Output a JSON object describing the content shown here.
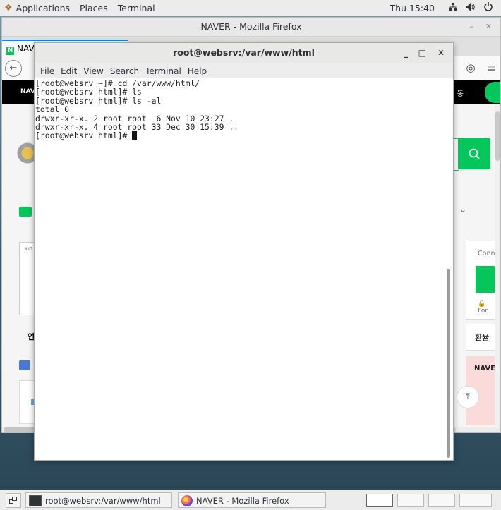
{
  "topbar": {
    "applications": "Applications",
    "places": "Places",
    "terminal": "Terminal",
    "clock": "Thu 15:40",
    "icons": [
      "network-icon",
      "volume-icon",
      "power-icon"
    ]
  },
  "firefox": {
    "window_title": "NAVER - Mozilla Firefox",
    "tab_label": "NAV",
    "naver_logo": "NAV",
    "nav_right_text": "동",
    "right_card_label": "Conne",
    "right_card_lock": "🔒 For",
    "side_box_text": "un",
    "label_yeon": "연",
    "exchange_label": "환율",
    "pink_card_label": "NAVE"
  },
  "terminal": {
    "window_title": "root@websrv:/var/www/html",
    "menu": [
      "File",
      "Edit",
      "View",
      "Search",
      "Terminal",
      "Help"
    ],
    "lines": [
      {
        "text": "[root@websrv ~]# cd /var/www/html/",
        "dir": ""
      },
      {
        "text": "[root@websrv html]# ls",
        "dir": ""
      },
      {
        "text": "[root@websrv html]# ls -al",
        "dir": ""
      },
      {
        "text": "total 0",
        "dir": ""
      },
      {
        "text": "drwxr-xr-x. 2 root root  6 Nov 10 23:27 ",
        "dir": "."
      },
      {
        "text": "drwxr-xr-x. 4 root root 33 Dec 30 15:39 ",
        "dir": ".."
      }
    ],
    "prompt": "[root@websrv html]# "
  },
  "taskbar": {
    "tasks": [
      {
        "label": "root@websrv:/var/www/html",
        "icon": "terminal-icon"
      },
      {
        "label": "NAVER - Mozilla Firefox",
        "icon": "firefox-icon"
      }
    ],
    "workspaces": 4,
    "active_workspace": 1
  }
}
